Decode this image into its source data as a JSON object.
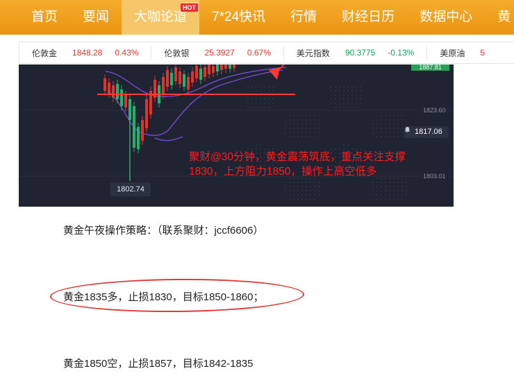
{
  "nav": {
    "items": [
      {
        "label": "首页"
      },
      {
        "label": "要闻"
      },
      {
        "label": "大咖论道",
        "badge": "HOT"
      },
      {
        "label": "7*24快讯"
      },
      {
        "label": "行情"
      },
      {
        "label": "财经日历"
      },
      {
        "label": "数据中心"
      },
      {
        "label": "黄"
      }
    ]
  },
  "ticker": [
    {
      "name": "伦敦金",
      "price": "1848.28",
      "change": "0.43%",
      "direction": "up"
    },
    {
      "name": "伦敦银",
      "price": "25.3927",
      "change": "0.67%",
      "direction": "up"
    },
    {
      "name": "美元指数",
      "price": "90.3775",
      "change": "-0.13%",
      "direction": "down"
    },
    {
      "name": "美原油",
      "price": "5",
      "change": "",
      "direction": "up"
    }
  ],
  "chart": {
    "price_labels": {
      "level1": "1823.60",
      "level2": "1803.01",
      "top": "1887.81"
    },
    "current_price": "1817.06",
    "low_price": "1802.74",
    "annotation_line1": "聚财@30分钟，黄金震荡筑底，重点关注支撑",
    "annotation_line2": "1830，上方阻力1850，操作上高空低多",
    "colors": {
      "background": "#1f2332",
      "bull": "#e0332f",
      "bear": "#23b26a",
      "band": "#7c4dd8",
      "support": "#ff3b30"
    }
  },
  "article": {
    "title_line": "黄金午夜操作策略：（联系聚财：jccf6606）",
    "long_strategy": "黄金1835多，止损1830，目标1850-1860；",
    "short_strategy": "黄金1850空，止损1857，目标1842-1835"
  }
}
